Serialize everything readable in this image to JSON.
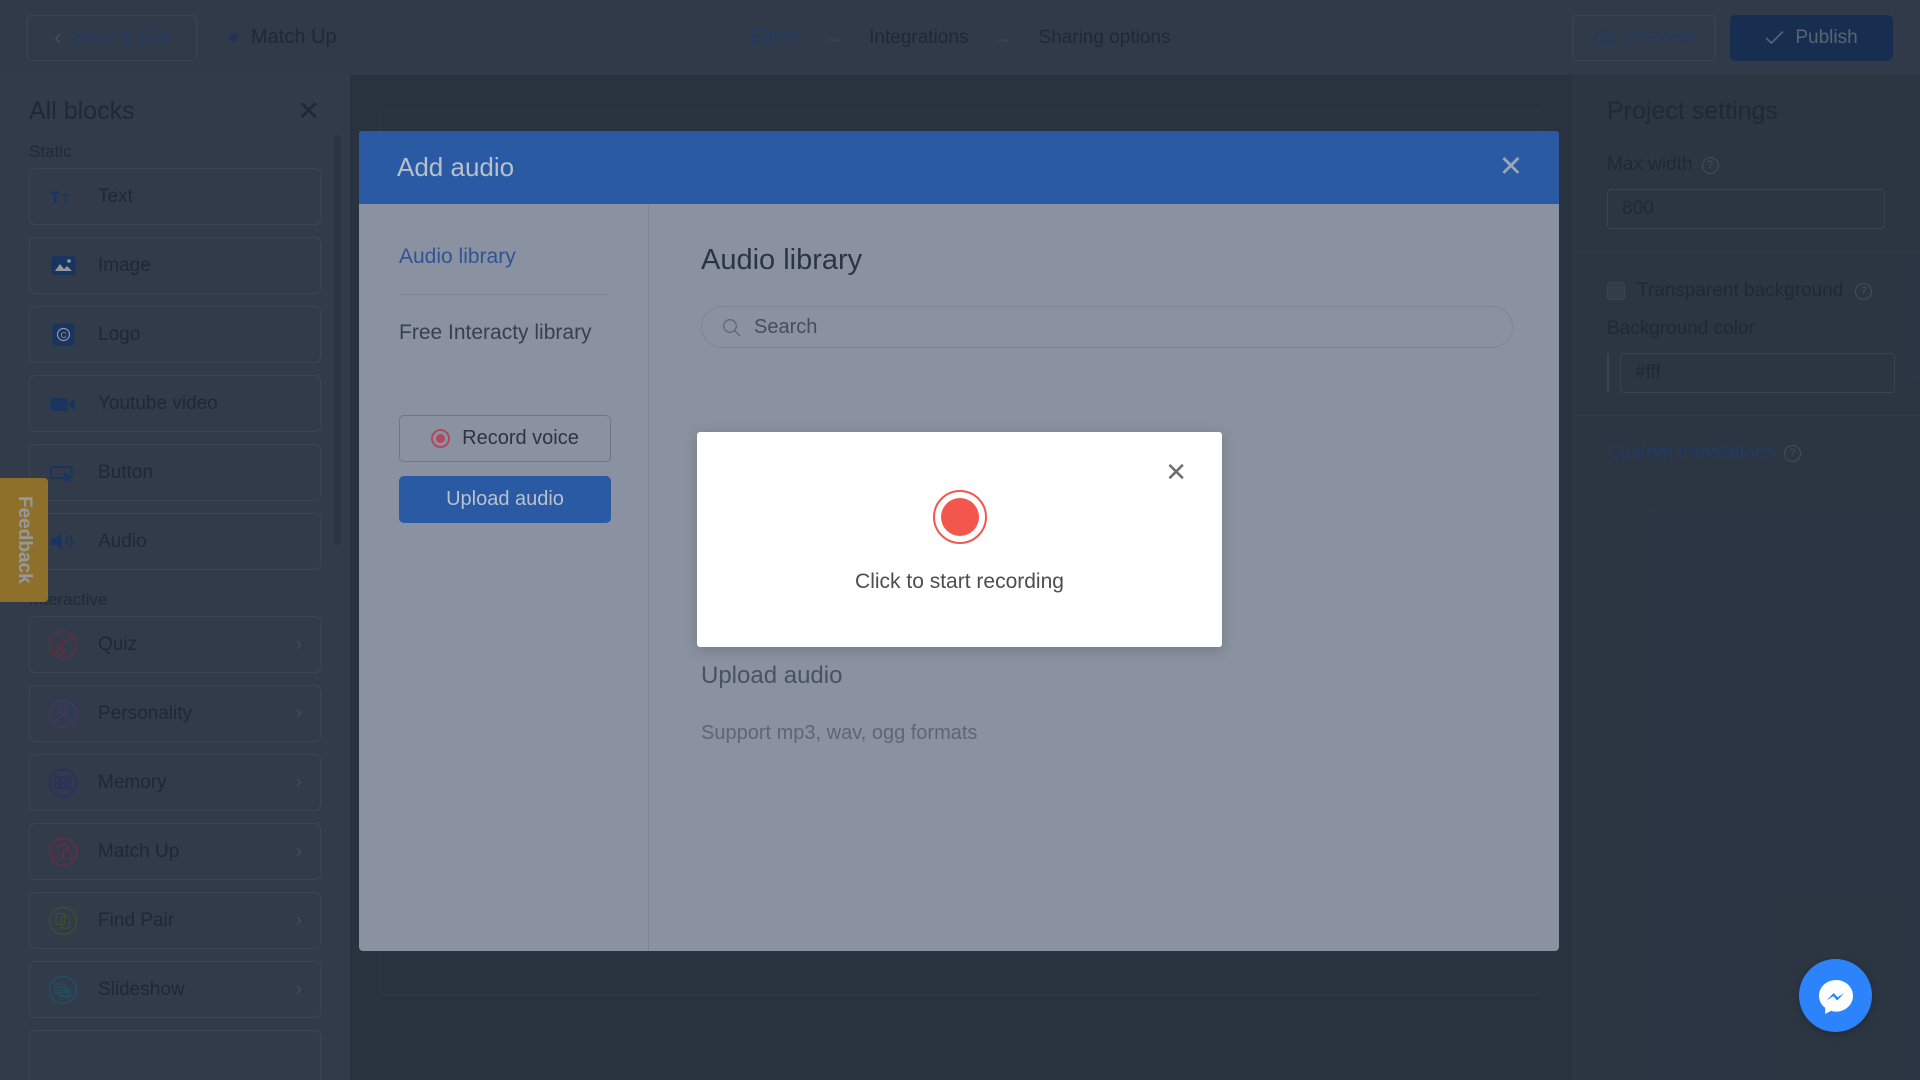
{
  "topbar": {
    "save_exit_label": "Save & Exit",
    "back_icon": "chevron-left-icon",
    "project_name": "Match Up",
    "breadcrumb": [
      {
        "label": "Editor",
        "active": true
      },
      {
        "label": "Integrations",
        "active": false
      },
      {
        "label": "Sharing options",
        "active": false
      }
    ],
    "breadcrumb_arrow": "→",
    "preview_label": "Preview",
    "preview_icon": "eye-icon",
    "publish_label": "Publish",
    "publish_icon": "check-icon"
  },
  "sidebar": {
    "title": "All blocks",
    "close_icon": "close-icon",
    "sections": [
      {
        "label": "Static",
        "items": [
          {
            "label": "Text",
            "icon": "text-format-icon",
            "chevron": false
          },
          {
            "label": "Image",
            "icon": "image-icon",
            "chevron": false
          },
          {
            "label": "Logo",
            "icon": "logo-copyright-icon",
            "chevron": false
          },
          {
            "label": "Youtube video",
            "icon": "video-camera-icon",
            "chevron": false
          },
          {
            "label": "Button",
            "icon": "button-cursor-icon",
            "chevron": false
          },
          {
            "label": "Audio",
            "icon": "speaker-icon",
            "chevron": false
          }
        ]
      },
      {
        "label": "Interactive",
        "items": [
          {
            "label": "Quiz",
            "icon": "quiz-icon",
            "chevron": true
          },
          {
            "label": "Personality",
            "icon": "personality-icon",
            "chevron": true
          },
          {
            "label": "Memory",
            "icon": "memory-grid-icon",
            "chevron": true
          },
          {
            "label": "Match Up",
            "icon": "match-up-icon",
            "chevron": true
          },
          {
            "label": "Find Pair",
            "icon": "find-pair-icon",
            "chevron": true
          },
          {
            "label": "Slideshow",
            "icon": "slideshow-icon",
            "chevron": true
          }
        ]
      }
    ]
  },
  "feedback_tab": {
    "label": "Feedback",
    "color": "#f5b730"
  },
  "right_panel": {
    "title": "Project settings",
    "max_width_label": "Max width",
    "max_width_value": "800",
    "transparent_background_label": "Transparent background",
    "background_color_label": "Background color",
    "background_color_value": "#fff",
    "custom_translations_label": "Custom translations",
    "help_icon": "help-question-icon"
  },
  "modal": {
    "title": "Add audio",
    "close_icon": "close-icon",
    "nav": [
      {
        "label": "Audio library",
        "active": true
      },
      {
        "label": "Free Interacty library",
        "active": false
      }
    ],
    "record_voice_label": "Record voice",
    "record_voice_icon": "record-dot-icon",
    "upload_audio_label": "Upload audio",
    "main_title": "Audio library",
    "search_placeholder": "Search",
    "search_value": "",
    "search_icon": "search-icon",
    "behind_title": "Upload audio",
    "behind_note": "Support mp3, wav, ogg formats"
  },
  "record_popup": {
    "close_icon": "close-icon",
    "record_button_icon": "record-circle-icon",
    "prompt": "Click to start recording",
    "accent_color": "#f2564c"
  },
  "messenger": {
    "icon": "messenger-icon",
    "color": "#2c83fb"
  },
  "colors": {
    "topbar_bg": "#475569",
    "sidebar_bg": "#4a5668",
    "right_panel_bg": "#414d5e",
    "modal_header_bg": "#2a5aa4",
    "modal_bg": "#8a92a1",
    "accent_blue": "#2f5496"
  }
}
